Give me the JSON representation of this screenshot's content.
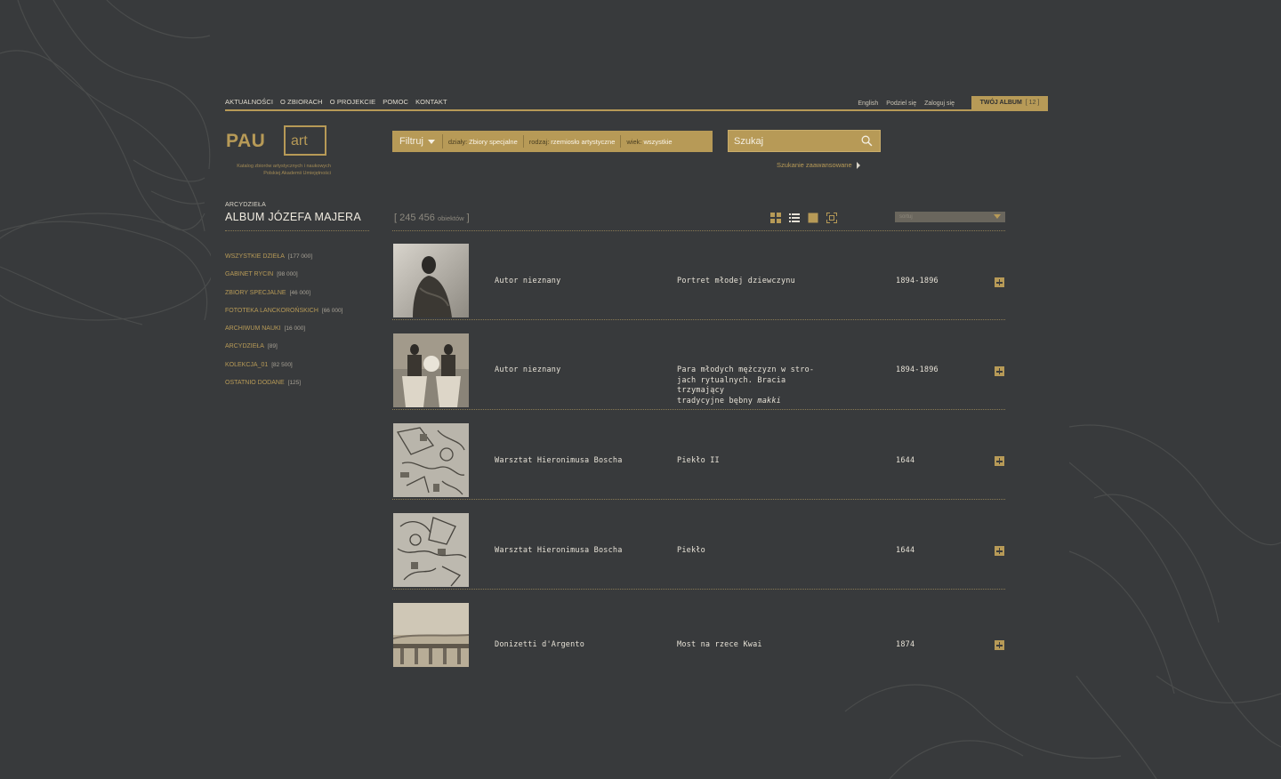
{
  "brand": {
    "logo_left": "PAU",
    "logo_right": "art",
    "tagline_1": "Katalog zbiorów artystycznych i naukowych",
    "tagline_2": "Polskiej Akademii Umiejętności"
  },
  "topnav": {
    "items": [
      "AKTUALNOŚCI",
      "O ZBIORACH",
      "O PROJEKCIE",
      "POMOC",
      "KONTAKT"
    ],
    "lang": "English",
    "share": "Podziel się",
    "login": "Zaloguj się",
    "album_label": "TWÓJ ALBUM",
    "album_count": "[ 12 ]"
  },
  "filter": {
    "title": "Filtruj",
    "dzialy_label": "działy:",
    "dzialy_value": "Zbiory specjalne",
    "rodzaj_label": "rodzaj:",
    "rodzaj_value": "rzemiosło artystyczne",
    "wiek_label": "wiek:",
    "wiek_value": "wszystkie"
  },
  "search": {
    "placeholder": "Szukaj",
    "advanced": "Szukanie zaawansowane"
  },
  "sidebar": {
    "category": "ARCYDZIEŁA",
    "title": "ALBUM JÓZEFA MAJERA",
    "items": [
      {
        "label": "WSZYSTKIE DZIEŁA",
        "count": "[177 000]"
      },
      {
        "label": "GABINET RYCIN",
        "count": "[98 000]"
      },
      {
        "label": "ZBIORY SPECJALNE",
        "count": "[46 000]"
      },
      {
        "label": "FOTOTEKA LANCKOROŃSKICH",
        "count": "[66 000]"
      },
      {
        "label": "ARCHIWUM NAUKI",
        "count": "[16 000]"
      },
      {
        "label": "ARCYDZIEŁA",
        "count": "[89]"
      },
      {
        "label": "KOLEKCJA_01",
        "count": "[82 500]"
      },
      {
        "label": "OSTATNIO DODANE",
        "count": "[125]"
      }
    ]
  },
  "results": {
    "count_open": "[",
    "count_value": "245 456",
    "count_unit": "obiektów",
    "count_close": "]",
    "sort_label": "sortuj",
    "rows": [
      {
        "author": "Autor nieznany",
        "title": "Portret młodej dziewczynu",
        "date": "1894-1896"
      },
      {
        "author": "Autor nieznany",
        "title_1": "Para młodych mężczyzn w stro-",
        "title_2": "jach rytualnych. Bracia trzymający",
        "title_3": "tradycyjne bębny ",
        "title_em": "makki",
        "date": "1894-1896"
      },
      {
        "author": "Warsztat Hieronimusa Boscha",
        "title": "Piekło II",
        "date": "1644"
      },
      {
        "author": "Warsztat Hieronimusa Boscha",
        "title": "Piekło",
        "date": "1644"
      },
      {
        "author": "Donizetti d'Argento",
        "title": "Most na rzece Kwai",
        "date": "1874"
      }
    ]
  },
  "colors": {
    "background": "#383a3c",
    "accent": "#b79a57"
  }
}
